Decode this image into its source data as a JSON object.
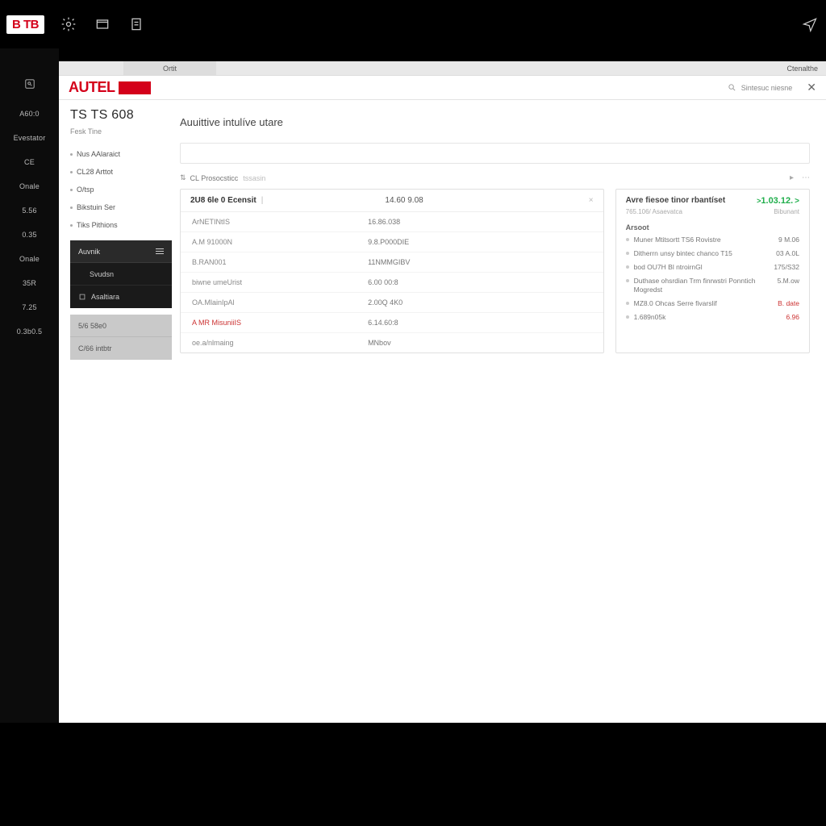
{
  "topbar": {
    "logo": "B TB"
  },
  "darkSidebar": {
    "items": [
      "A60:0",
      "Evestator",
      "CE",
      "Onale",
      "5.56",
      "0.35",
      "Onale",
      "35R",
      "7.25",
      "0.3b0.5"
    ]
  },
  "frameTop": {
    "tab": "Ortit",
    "right": "Ctenalthe"
  },
  "header": {
    "brand": "AUTEL",
    "searchLabel": "Sintesuc niesne"
  },
  "nav2": {
    "title": "TS TS 608",
    "subtitle": "Fesk Tine",
    "items": [
      "Nus AAlaraict",
      "CL28 Arttot",
      "O/tsp",
      "Bikstuin Ser",
      "Tiks Pithions"
    ],
    "blockA": [
      {
        "label": "Auvnik",
        "icon": true
      },
      {
        "label": "Svudsn"
      },
      {
        "label": "Asaltiara"
      }
    ],
    "blockB": [
      {
        "label": "5/6 58e0"
      },
      {
        "label": "C/66 intbtr"
      }
    ]
  },
  "main": {
    "title": "Auuittive intulíve utare",
    "filter": {
      "label": "CL Prosocsticc",
      "sub": "tssasin"
    },
    "panelLeft": {
      "title": "2U8 6le 0 Ecensit",
      "mid": "14.60 9.08",
      "rows": [
        {
          "c1": "ArNETINtIS",
          "c2": "16.86.038"
        },
        {
          "c1": "A.M 91000N",
          "c2": "9.8.P000DIE"
        },
        {
          "c1": "B.RAN001",
          "c2": "11NMMGIBV"
        },
        {
          "c1": "biwne umeUrist",
          "c2": "6.00 00:8"
        },
        {
          "c1": "OA.MlainIpAl",
          "c2": "2.00Q 4K0"
        },
        {
          "c1": "A MR MisuniiIS",
          "c2": "6.14.60:8",
          "red": true
        },
        {
          "c1": "oe.a/nlmaing",
          "c2": "MNbov"
        }
      ]
    },
    "panelRight": {
      "title": "Avre fiesoe tinor rbantíset",
      "amount": "1.03.12.",
      "sub1": "765.106/ Asaevatca",
      "sub2": "Bibunant",
      "section": "Arsoot",
      "rows": [
        {
          "txt": "Muner Mtitsortt TS6 Rovistre",
          "val": "9 M.06"
        },
        {
          "txt": "Ditherrn unsy bintec chanco T15",
          "val": "03 A.0L"
        },
        {
          "txt": "bod OU7H Bl ntroirnGl",
          "val": "175/S32"
        },
        {
          "txt": "Duthase ohsrdian Trm finrwstri Ponntich Mogredst",
          "val": "5.M.ow"
        },
        {
          "txt": "MZ8.0 Ohcas Serre fivarslif",
          "val": "B. date",
          "red": true
        },
        {
          "txt": "1.689n05k",
          "val": "6.96",
          "red": true
        }
      ]
    }
  }
}
